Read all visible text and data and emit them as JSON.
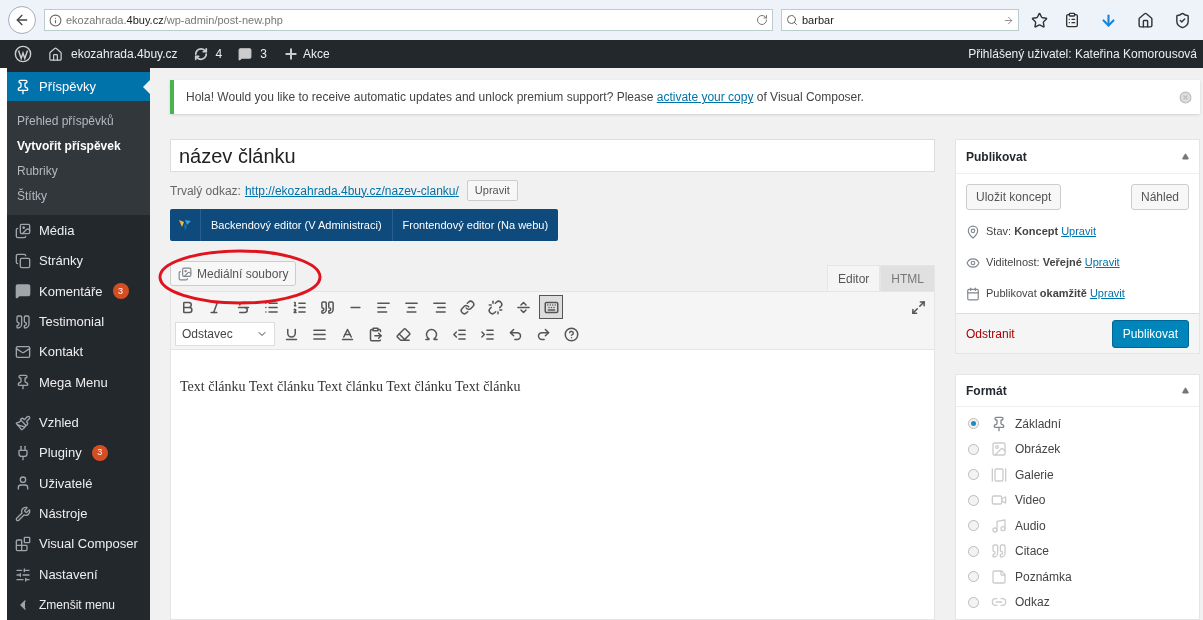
{
  "browser": {
    "url": "ekozahrada.**4buy.cz**/wp-admin/post-new.php",
    "search": {
      "value": "barbar"
    }
  },
  "admin_bar": {
    "site": "ekozahrada.4buy.cz",
    "updates": "4",
    "comments": "3",
    "new": "Akce",
    "user": "Přihlášený uživatel: Kateřina Komorousová"
  },
  "sidebar": {
    "items": [
      {
        "label": "Příspěvky",
        "selected": true,
        "children": [
          {
            "label": "Přehled příspěvků",
            "selected": false
          },
          {
            "label": "Vytvořit příspěvek",
            "selected": true
          },
          {
            "label": "Rubriky",
            "selected": false
          },
          {
            "label": "Štítky",
            "selected": false
          }
        ]
      },
      {
        "label": "Média",
        "selected": false
      },
      {
        "label": "Stránky",
        "selected": false
      },
      {
        "label": "Komentáře",
        "selected": false,
        "badge": "3"
      },
      {
        "label": "Testimonial",
        "selected": false
      },
      {
        "label": "Kontakt",
        "selected": false
      },
      {
        "label": "Mega Menu",
        "selected": false
      },
      {
        "label": "Vzhled",
        "selected": false,
        "gap_before": true
      },
      {
        "label": "Pluginy",
        "selected": false,
        "badge": "3"
      },
      {
        "label": "Uživatelé",
        "selected": false
      },
      {
        "label": "Nástroje",
        "selected": false
      },
      {
        "label": "Visual Composer",
        "selected": false
      },
      {
        "label": "Nastavení",
        "selected": false
      },
      {
        "label": "Zmenšit menu",
        "selected": false
      }
    ]
  },
  "notice": {
    "text_before": "Hola! Would you like to receive automatic updates and unlock premium support? Please",
    "link": "activate your copy",
    "text_after": "of Visual Composer."
  },
  "title_field": {
    "value": "název článku"
  },
  "permalink": {
    "label": "Trvalý odkaz:",
    "url": "http://ekozahrada.4buy.cz/**nazev-clanku**/",
    "button": "Upravit"
  },
  "vc_bar": {
    "buttons": [
      "Backendový editor (V Administraci)",
      "Frontendový editor (Na webu)"
    ]
  },
  "media_button": "Mediální soubory",
  "editor_tabs": [
    {
      "label": "Editor",
      "selected": true
    },
    {
      "label": "HTML",
      "selected": false
    }
  ],
  "toolbar": {
    "format_select": "Odstavec",
    "toggle_pressed": true
  },
  "content": "Text článku Text článku Text článku Text článku Text článku",
  "publish_box": {
    "title": "Publikovat",
    "save_draft": "Uložit koncept",
    "preview": "Náhled",
    "rows": [
      {
        "label": "Stav:",
        "value": "Koncept",
        "link": "Upravit"
      },
      {
        "label": "Viditelnost:",
        "value": "Veřejné",
        "link": "Upravit"
      },
      {
        "label": "Publikovat",
        "value": "okamžitě",
        "link": "Upravit"
      }
    ],
    "delete": "Odstranit",
    "publish": "Publikovat"
  },
  "format_box": {
    "title": "Formát",
    "options": [
      {
        "label": "Základní",
        "selected": true
      },
      {
        "label": "Obrázek",
        "selected": false
      },
      {
        "label": "Galerie",
        "selected": false
      },
      {
        "label": "Video",
        "selected": false
      },
      {
        "label": "Audio",
        "selected": false
      },
      {
        "label": "Citace",
        "selected": false
      },
      {
        "label": "Poznámka",
        "selected": false
      },
      {
        "label": "Odkaz",
        "selected": false
      }
    ]
  }
}
